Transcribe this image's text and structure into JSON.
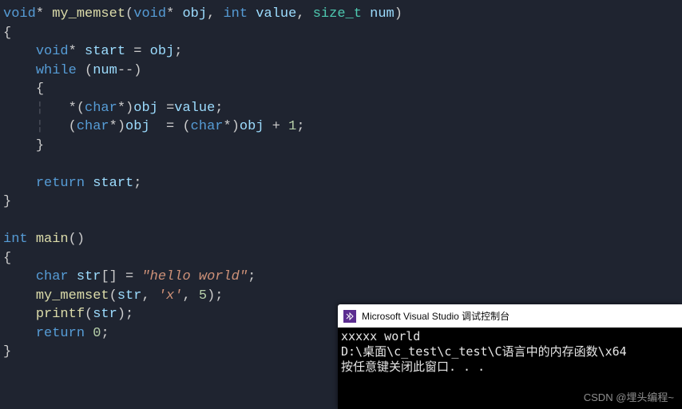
{
  "code": {
    "fn1": {
      "ret_type": "void",
      "star": "*",
      "name": "my_memset",
      "params": {
        "p1_type": "void",
        "p1_star": "*",
        "p1_name": "obj",
        "p2_type": "int",
        "p2_name": "value",
        "p3_type": "size_t",
        "p3_name": "num"
      },
      "body": {
        "decl_type": "void",
        "decl_star": "*",
        "decl_name": "start",
        "decl_assign": "=",
        "decl_rhs": "obj",
        "while_kw": "while",
        "while_var": "num",
        "while_op": "--",
        "line1_star": "*",
        "line1_char": "char",
        "line1_castp": "*",
        "line1_lhs": "obj",
        "line1_eq": "=",
        "line1_rhs": "value",
        "line2_char1": "char",
        "line2_cast1": "*",
        "line2_lhs": "obj",
        "line2_eq": "=",
        "line2_char2": "char",
        "line2_cast2": "*",
        "line2_rhs": "obj",
        "line2_plus": "+",
        "line2_one": "1",
        "ret_kw": "return",
        "ret_val": "start"
      }
    },
    "fn2": {
      "ret_type": "int",
      "name": "main",
      "body": {
        "decl_type": "char",
        "decl_name": "str",
        "decl_br": "[]",
        "decl_eq": "=",
        "decl_val": "\"hello world\"",
        "call1_fn": "my_memset",
        "call1_a1": "str",
        "call1_a2": "'x'",
        "call1_a3": "5",
        "call2_fn": "printf",
        "call2_a1": "str",
        "ret_kw": "return",
        "ret_val": "0"
      }
    }
  },
  "console": {
    "title": "Microsoft Visual Studio 调试控制台",
    "line1": "xxxxx world",
    "line2": "D:\\桌面\\c_test\\c_test\\C语言中的内存函数\\x64",
    "line3": "按任意键关闭此窗口. . ."
  },
  "watermark": "CSDN @埋头编程~"
}
